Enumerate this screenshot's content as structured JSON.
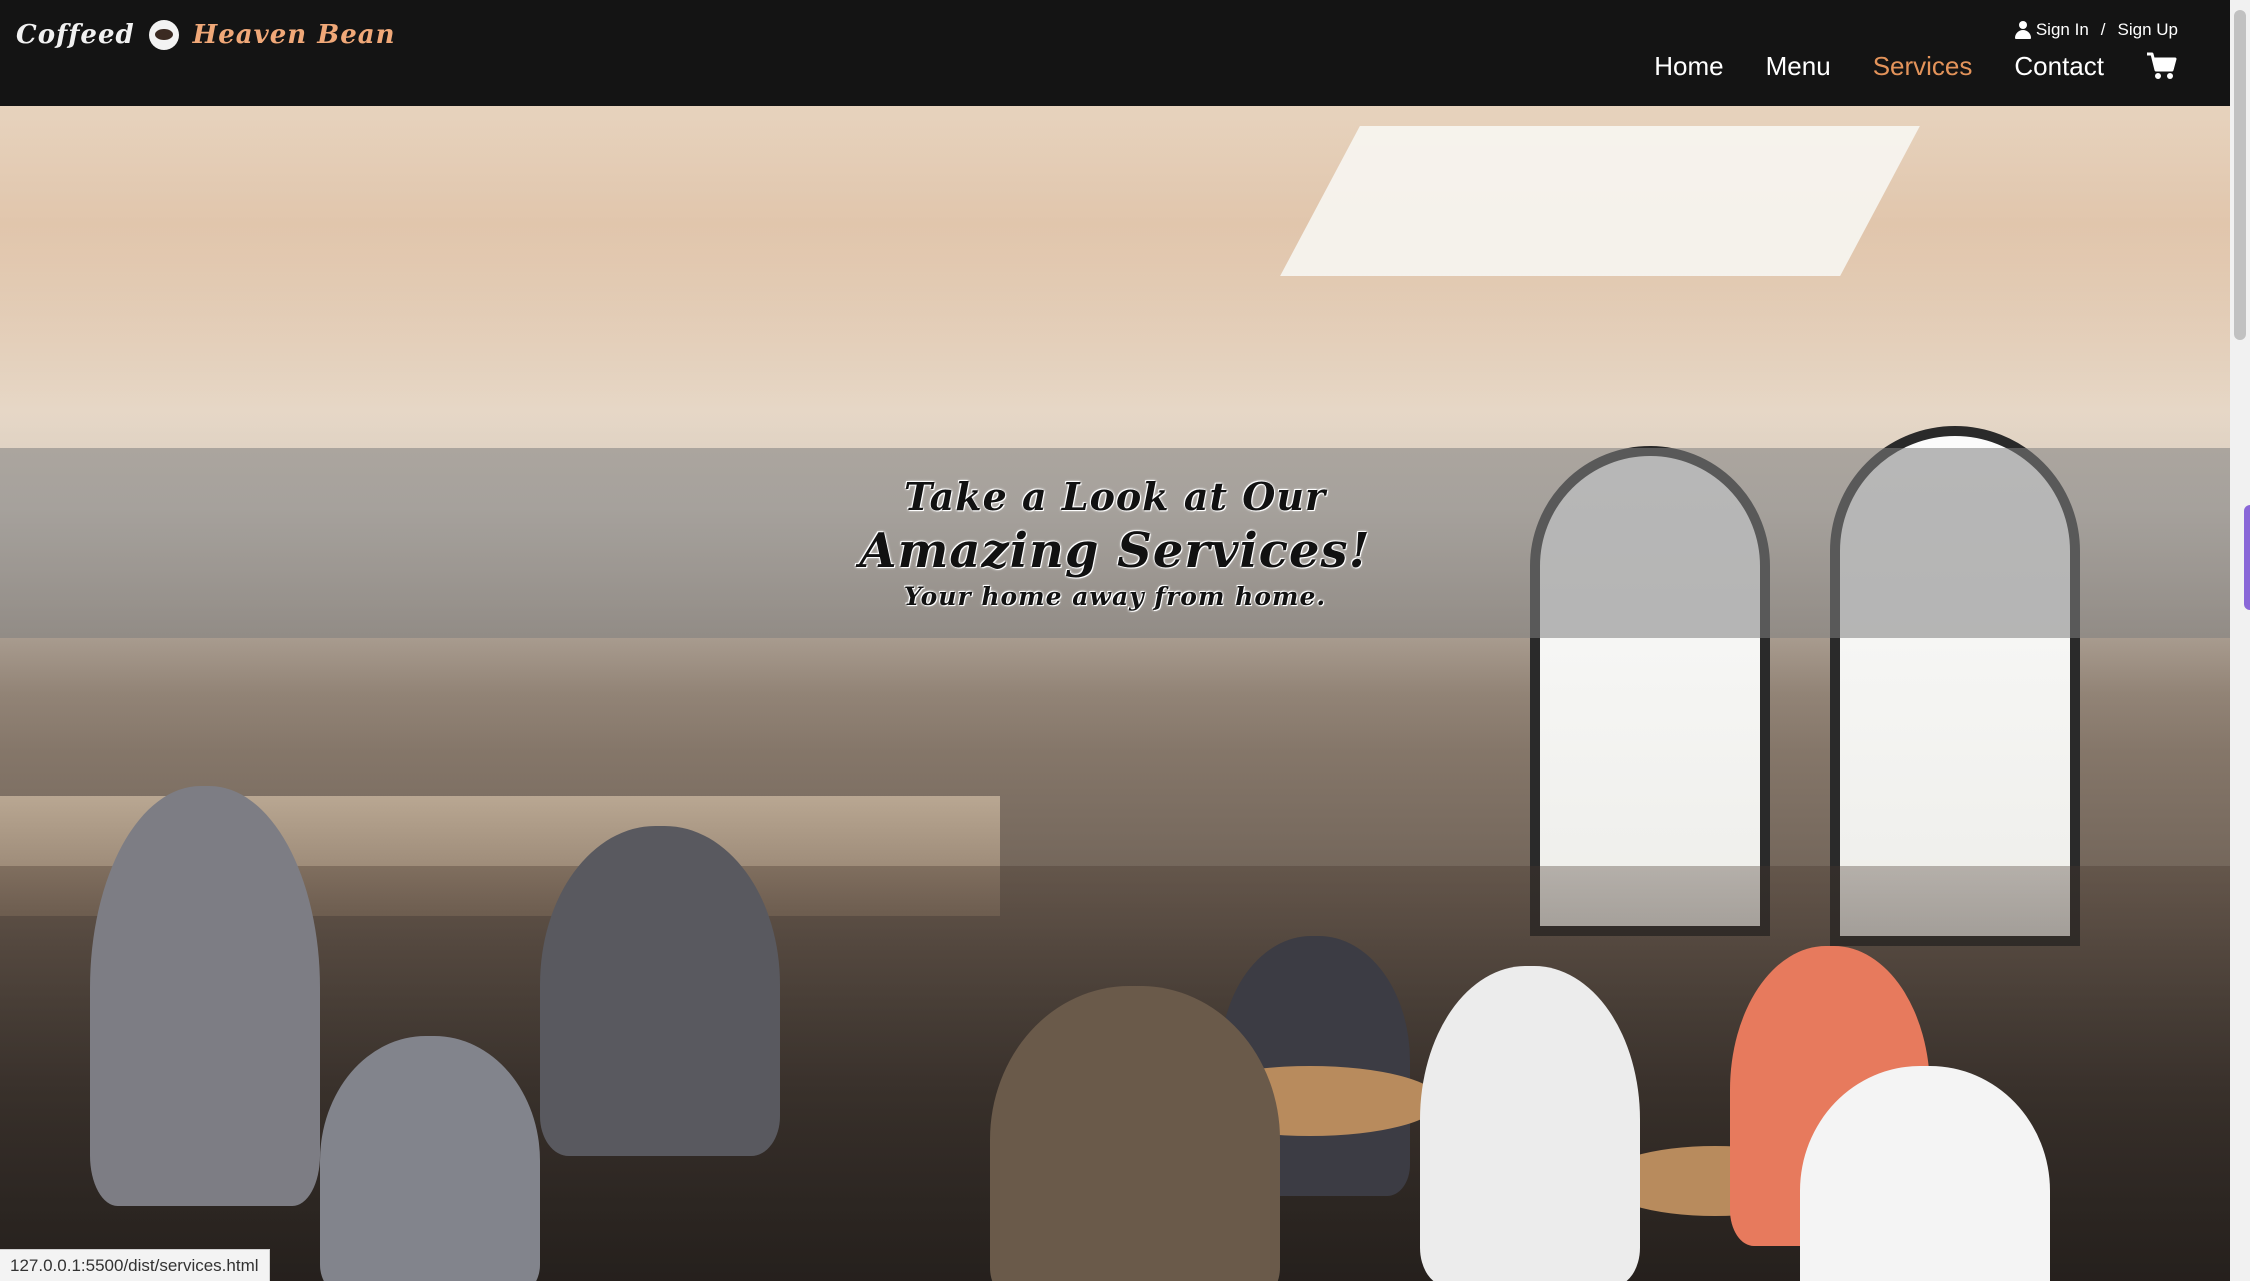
{
  "brand": {
    "word1": "Coffeed",
    "word2": "Heaven Bean",
    "logo_icon": "coffee-cup-icon"
  },
  "auth": {
    "sign_in": "Sign In",
    "separator": "/",
    "sign_up": "Sign Up"
  },
  "nav": {
    "items": [
      {
        "label": "Home",
        "active": false
      },
      {
        "label": "Menu",
        "active": false
      },
      {
        "label": "Services",
        "active": true
      },
      {
        "label": "Contact",
        "active": false
      }
    ],
    "cart_icon": "cart-icon"
  },
  "hero": {
    "title": "Take a Look at Our",
    "headline": "Amazing Services!",
    "tagline": "Your home away from home.",
    "background": "cafe-interior-photo"
  },
  "status_bar": {
    "url": "127.0.0.1:5500/dist/services.html"
  },
  "colors": {
    "navbar_bg": "#141414",
    "accent": "#e3935a",
    "brand_accent": "#f0a878",
    "banner_overlay": "rgba(128,128,128,0.55)"
  }
}
